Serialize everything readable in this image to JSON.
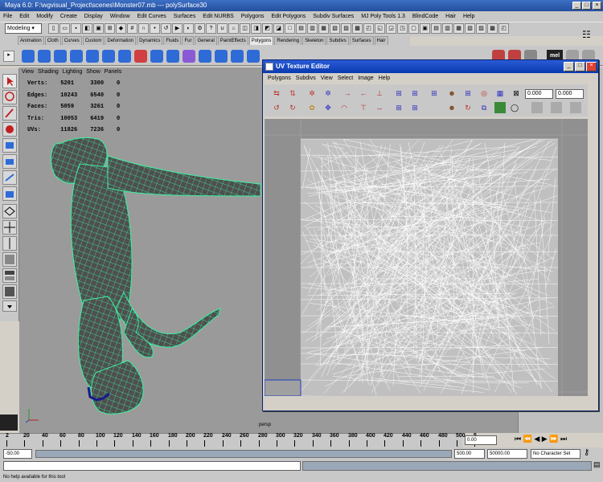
{
  "app": {
    "title": "Maya 6.0: F:\\wgvisual_Project\\scenes\\Monster07.mb   ---   polySurface30"
  },
  "menubar": [
    "File",
    "Edit",
    "Modify",
    "Create",
    "Display",
    "Window",
    "Edit Curves",
    "Surfaces",
    "Edit NURBS",
    "Polygons",
    "Edit Polygons",
    "Subdiv Surfaces",
    "MJ Poly Tools 1.3",
    "BlindCode",
    "Hair",
    "Help"
  ],
  "status": {
    "mode": "Modeling",
    "script_label": "mel"
  },
  "shelf_tabs": [
    "Animation",
    "Cloth",
    "Curves",
    "Custom",
    "Deformation",
    "Dynamics",
    "Fluids",
    "Fur",
    "General",
    "PaintEffects",
    "Polygons",
    "Rendering",
    "Skeleton",
    "Subdivs",
    "Surfaces",
    "Hair"
  ],
  "viewport": {
    "menu": [
      "View",
      "Shading",
      "Lighting",
      "Show",
      "Panels"
    ],
    "hud": [
      {
        "label": "Verts:",
        "a": "5201",
        "b": "3300",
        "c": "0"
      },
      {
        "label": "Edges:",
        "a": "10243",
        "b": "6540",
        "c": "0"
      },
      {
        "label": "Faces:",
        "a": "5059",
        "b": "3261",
        "c": "0"
      },
      {
        "label": "Tris:",
        "a": "10053",
        "b": "6419",
        "c": "0"
      },
      {
        "label": "UVs:",
        "a": "11826",
        "b": "7236",
        "c": "0"
      }
    ],
    "camera": "persp"
  },
  "uv_editor": {
    "title": "UV Texture Editor",
    "menu": [
      "Polygons",
      "Subdivs",
      "View",
      "Select",
      "Image",
      "Help"
    ],
    "field1": "0.000",
    "field2": "0.000"
  },
  "timeline": {
    "ticks": [
      "2",
      "20",
      "40",
      "60",
      "80",
      "100",
      "120",
      "140",
      "160",
      "180",
      "200",
      "220",
      "240",
      "260",
      "280",
      "300",
      "320",
      "340",
      "360",
      "380",
      "400",
      "420",
      "440",
      "460",
      "480",
      "500",
      "5"
    ],
    "current": "0.00"
  },
  "range": {
    "start": "-50.00",
    "end": "500.00",
    "end2": "50000.00",
    "character": "No Character Set"
  },
  "help": "No help available for this tool"
}
